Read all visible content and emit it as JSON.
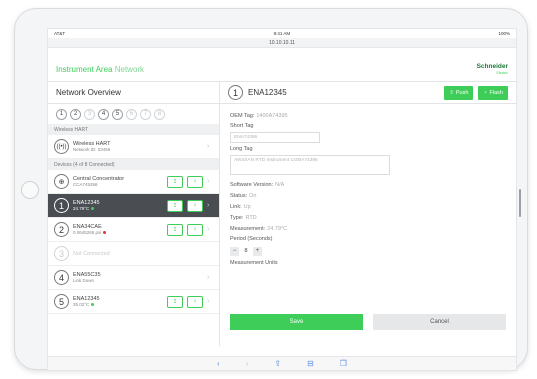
{
  "status_bar": {
    "carrier": "AT&T",
    "wifi_icon": "wifi-icon",
    "time": "9:41 AM",
    "battery": "100%"
  },
  "browser": {
    "url": "10.10.10.11"
  },
  "app": {
    "title": "Instrument Area",
    "title_suffix": "Network",
    "logo": "Schneider",
    "logo_sub": "Electric",
    "brand_color": "#3dcd58"
  },
  "left_panel": {
    "title": "Network Overview",
    "steps": [
      "1",
      "2",
      "3",
      "4",
      "5",
      "6",
      "7",
      "8"
    ],
    "section_wireless": "Wireless HART",
    "wireless": {
      "name": "Wireless HART",
      "sub": "Network ID: 03456"
    },
    "section_devices": "Devices (4 of 8 Connected)",
    "devices": [
      {
        "num": "",
        "name": "Central Concentrator",
        "sub": "CCA745358"
      },
      {
        "num": "1",
        "name": "ENA12345",
        "sub": "24.79°C"
      },
      {
        "num": "2",
        "name": "ENA34CAE",
        "sub": "0.0645265 psi"
      },
      {
        "num": "3",
        "name": "Not Connected",
        "sub": ""
      },
      {
        "num": "4",
        "name": "ENA55C35",
        "sub": "Link Down"
      },
      {
        "num": "5",
        "name": "ENA12345",
        "sub": "35.02°C"
      }
    ]
  },
  "detail": {
    "num": "1",
    "title": "ENA12345",
    "push_label": "Push",
    "flash_label": "Flash",
    "oem_label": "OEM Tag:",
    "oem_value": "1400A74395",
    "short_tag_label": "Short Tag",
    "short_tag_value": "ENA74395",
    "long_tag_label": "Long Tag",
    "long_tag_value": "AWS/IAN RTD Instrument 1400A74395",
    "software_label": "Software Version:",
    "software_value": "N/A",
    "status_label": "Status:",
    "status_value": "On",
    "link_label": "Link:",
    "link_value": "Up",
    "type_label": "Type:",
    "type_value": "RTD",
    "measurement_label": "Measurement:",
    "measurement_value": "24.79°C",
    "period_label": "Period (Seconds)",
    "period_value": "8",
    "minus": "−",
    "plus": "+",
    "units_label": "Measurement Units",
    "save_label": "Save",
    "cancel_label": "Cancel"
  },
  "safari_toolbar": {
    "back": "‹",
    "forward": "›",
    "share": "⇪",
    "bookmarks": "⊟",
    "tabs": "❐"
  }
}
